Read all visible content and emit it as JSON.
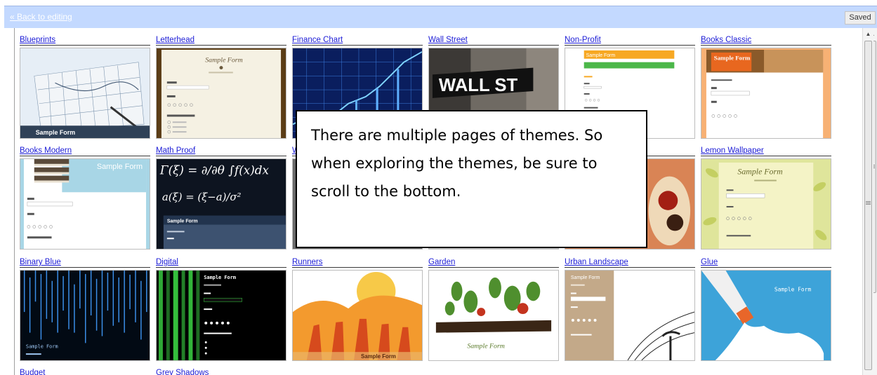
{
  "toolbar": {
    "back_label": "« Back to editing",
    "saved_label": "Saved"
  },
  "themes": [
    {
      "name": "Blueprints",
      "thumb_text": "Sample Form"
    },
    {
      "name": "Letterhead",
      "thumb_text": "Sample Form"
    },
    {
      "name": "Finance Chart",
      "thumb_text": ""
    },
    {
      "name": "Wall Street",
      "thumb_text": "WALL ST"
    },
    {
      "name": "Non-Profit",
      "thumb_text": "Sample Form"
    },
    {
      "name": "Books Classic",
      "thumb_text": "Sample Form"
    },
    {
      "name": "Books Modern",
      "thumb_text": "Sample Form"
    },
    {
      "name": "Math Proof",
      "thumb_text": "Sample Form"
    },
    {
      "name": "W",
      "thumb_text": ""
    },
    {
      "name": "",
      "thumb_text": ""
    },
    {
      "name": "",
      "thumb_text": ""
    },
    {
      "name": "Lemon Wallpaper",
      "thumb_text": "Sample Form"
    },
    {
      "name": "Binary Blue",
      "thumb_text": "Sample Form"
    },
    {
      "name": "Digital",
      "thumb_text": "Sample Form"
    },
    {
      "name": "Runners",
      "thumb_text": "Sample Form"
    },
    {
      "name": "Garden",
      "thumb_text": "Sample Form"
    },
    {
      "name": "Urban Landscape",
      "thumb_text": "Sample Form"
    },
    {
      "name": "Glue",
      "thumb_text": "Sample Form"
    },
    {
      "name": "Budget",
      "thumb_text": ""
    },
    {
      "name": "Grey Shadows",
      "thumb_text": ""
    }
  ],
  "callout": {
    "text": "There are multiple pages of themes. So when exploring the themes, be sure to scroll to the bottom."
  },
  "colors": {
    "topbar": "#c3d9ff",
    "link": "#1c1cd6"
  }
}
